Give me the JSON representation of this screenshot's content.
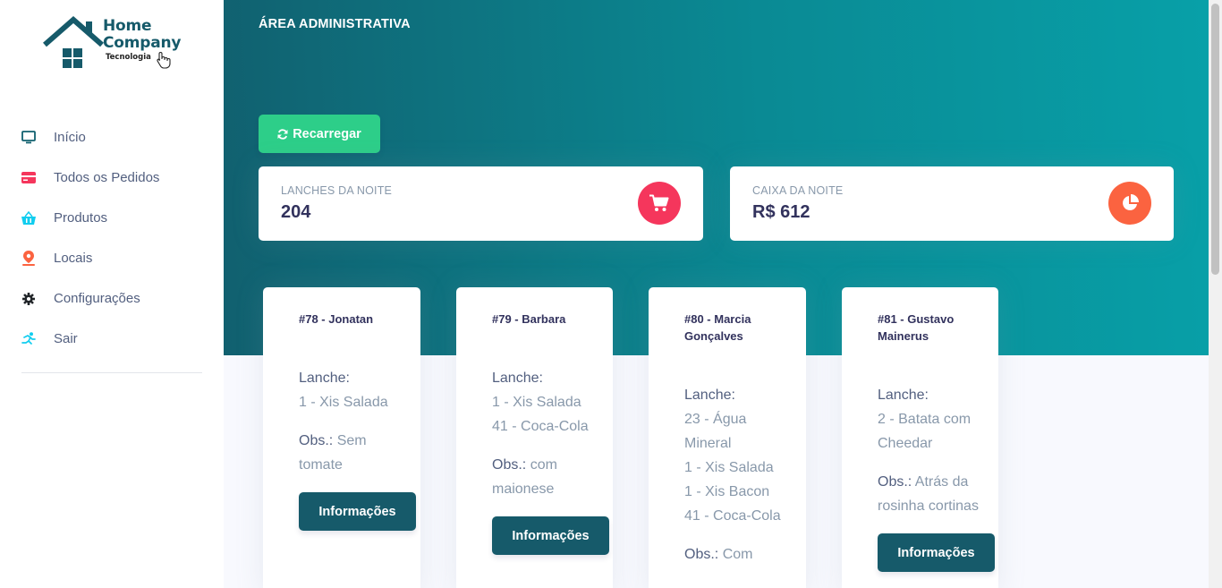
{
  "brand": {
    "line1": "Home",
    "line2": "Company",
    "line3": "Tecnologia"
  },
  "nav": [
    {
      "label": "Início",
      "icon": "monitor-icon",
      "color": "#11606f"
    },
    {
      "label": "Todos os Pedidos",
      "icon": "credit-card-icon",
      "color": "#f5365c"
    },
    {
      "label": "Produtos",
      "icon": "basket-icon",
      "color": "#11cdef"
    },
    {
      "label": "Locais",
      "icon": "map-pin-icon",
      "color": "#fb6340"
    },
    {
      "label": "Configurações",
      "icon": "gear-icon",
      "color": "#212529"
    },
    {
      "label": "Sair",
      "icon": "running-icon",
      "color": "#11cdef"
    }
  ],
  "header": {
    "title": "ÁREA ADMINISTRATIVA",
    "reload_label": "Recarregar"
  },
  "stats": [
    {
      "title": "LANCHES DA NOITE",
      "value": "204",
      "icon": "cart-icon",
      "color": "#f5365c"
    },
    {
      "title": "CAIXA DA NOITE",
      "value": "R$ 612",
      "icon": "pie-chart-icon",
      "color": "#fb6340"
    }
  ],
  "orders": [
    {
      "title": "#78 - Jonatan",
      "lanche_label": "Lanche:",
      "items": [
        "1 - Xis Salada"
      ],
      "obs_label": "Obs.:",
      "obs": "Sem tomate",
      "button": "Informações"
    },
    {
      "title": "#79 - Barbara",
      "lanche_label": "Lanche:",
      "items": [
        "1 - Xis Salada",
        "41 - Coca-Cola"
      ],
      "obs_label": "Obs.:",
      "obs": "com maionese",
      "button": "Informações"
    },
    {
      "title": "#80 - Marcia Gonçalves",
      "lanche_label": "Lanche:",
      "items": [
        "23 - Água Mineral",
        "1 - Xis Salada",
        "1 - Xis Bacon",
        "41 - Coca-Cola"
      ],
      "obs_label": "Obs.:",
      "obs": "Com",
      "button": "Informações"
    },
    {
      "title": "#81 - Gustavo Mainerus",
      "lanche_label": "Lanche:",
      "items": [
        "2 - Batata com Cheedar"
      ],
      "obs_label": "Obs.:",
      "obs": "Atrás da rosinha cortinas",
      "button": "Informações"
    }
  ],
  "colors": {
    "primary": "#165a6a",
    "success": "#2dce89",
    "header_start": "#11606f",
    "header_end": "#08a0a8"
  }
}
